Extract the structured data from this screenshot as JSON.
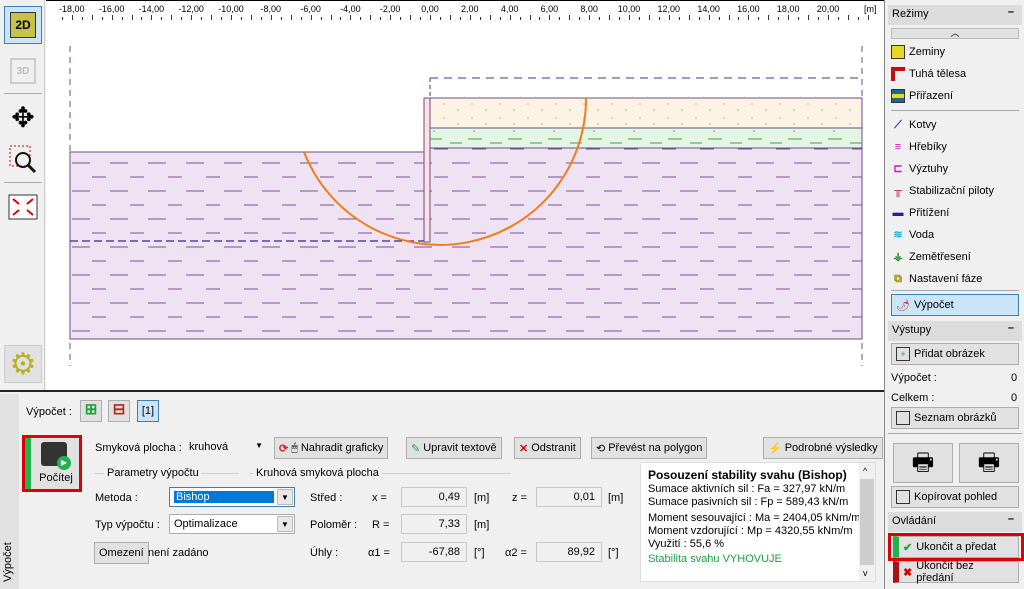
{
  "toolbar": {
    "view_2d": "2D",
    "view_3d": "3D"
  },
  "ruler": {
    "ticks": [
      "-18,00",
      "-16,00",
      "-14,00",
      "-12,00",
      "-10,00",
      "-8,00",
      "-6,00",
      "-4,00",
      "-2,00",
      "0,00",
      "2,00",
      "4,00",
      "6,00",
      "8,00",
      "10,00",
      "12,00",
      "14,00",
      "16,00",
      "18,00",
      "20,00"
    ],
    "unit": "[m]"
  },
  "colors": {
    "clay": "#efe3f3",
    "sand": "#fbf3e3",
    "silt": "#e3f5e3",
    "slip": "#f07c1c",
    "accent_green": "#22b14c",
    "accent_red": "#e00000"
  },
  "bottom": {
    "side_tab": "Výpočet",
    "calc_label": "Výpočet :",
    "stage_label": "[1]",
    "compute_button": "Počítej",
    "slip_label": "Smyková plocha :",
    "slip_value": "kruhová",
    "btn_replace": "Nahradit graficky",
    "btn_edit": "Upravit textově",
    "btn_remove": "Odstranit",
    "btn_polygon": "Převést na polygon",
    "btn_detail": "Podrobné výsledky",
    "params_title": "Parametry výpočtu",
    "method_label": "Metoda :",
    "method_value": "Bishop",
    "type_label": "Typ výpočtu :",
    "type_value": "Optimalizace",
    "limits_button": "Omezení",
    "limits_value": "není zadáno",
    "circle_title": "Kruhová smyková plocha",
    "center_label": "Střed :",
    "x_label": "x =",
    "x_value": "0,49",
    "x_unit": "[m]",
    "z_label": "z =",
    "z_value": "0,01",
    "z_unit": "[m]",
    "radius_label": "Poloměr :",
    "r_label": "R =",
    "r_value": "7,33",
    "r_unit": "[m]",
    "angles_label": "Úhly :",
    "a1_label": "α1 =",
    "a1_value": "-67,88",
    "a1_unit": "[°]",
    "a2_label": "α2 =",
    "a2_value": "89,92",
    "a2_unit": "[°]"
  },
  "results": {
    "title": "Posouzení stability svahu (Bishop)",
    "lines": [
      "Sumace aktivních sil :  Fa =   327,97  kN/m",
      "Sumace pasivních sil :  Fp =   589,43  kN/m",
      "Moment sesouvající :  Ma = 2404,05  kNm/m",
      "Moment vzdorující :    Mp = 4320,55  kNm/m",
      "Využití :  55,6  %"
    ],
    "verdict": "Stabilita svahu VYHOVUJE"
  },
  "sidebar": {
    "modes_title": "Režimy",
    "modes": [
      "Zeminy",
      "Tuhá tělesa",
      "Přiřazení"
    ],
    "modes2": [
      "Kotvy",
      "Hřebíky",
      "Výztuhy",
      "Stabilizační piloty",
      "Přitížení",
      "Voda",
      "Zemětřesení",
      "Nastavení fáze"
    ],
    "active": "Výpočet",
    "outputs_title": "Výstupy",
    "add_picture": "Přidat obrázek",
    "calc_count_label": "Výpočet :",
    "calc_count": "0",
    "total_label": "Celkem :",
    "total": "0",
    "picture_list": "Seznam obrázků",
    "copy_view": "Kopírovat pohled",
    "control_title": "Ovládání",
    "finish": "Ukončit a předat",
    "finish_no": "Ukončit bez předání"
  }
}
